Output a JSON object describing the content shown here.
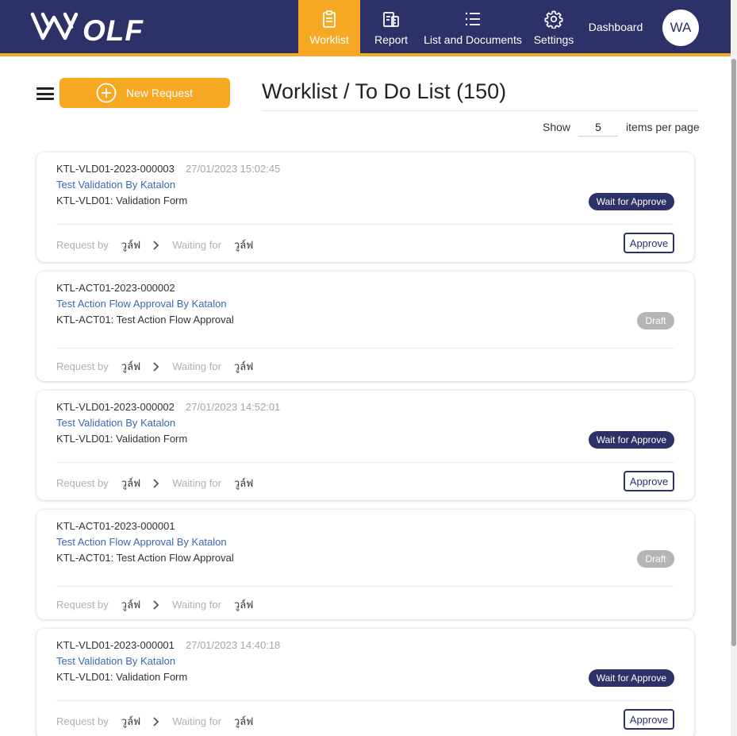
{
  "brand": {
    "logo_text": "WOLF",
    "color": "#2c3267",
    "accent": "#f7a823"
  },
  "nav": {
    "worklist": "Worklist",
    "report": "Report",
    "lists": "List and Documents",
    "settings": "Settings",
    "dashboard": "Dashboard",
    "avatar": "WA"
  },
  "toolbar": {
    "new_request": "New Request",
    "title": "Worklist / To Do List (150)",
    "show_label": "Show",
    "per_page": "5",
    "per_page_suffix": "items per page"
  },
  "footer_labels": {
    "request_by": "Request by",
    "waiting_for": "Waiting for"
  },
  "cards": [
    {
      "id": "KTL-VLD01-2023-000003",
      "date": "27/01/2023 15:02:45",
      "title": "Test Validation By Katalon",
      "form": "KTL-VLD01: Validation Form",
      "status": "Wait for Approve",
      "requester": "วูล์ฟ",
      "waiting": "วูล์ฟ",
      "action": "Approve"
    },
    {
      "id": "KTL-ACT01-2023-000002",
      "date": "",
      "title": "Test Action Flow Approval By Katalon",
      "form": "KTL-ACT01: Test Action Flow Approval",
      "status": "Draft",
      "requester": "วูล์ฟ",
      "waiting": "วูล์ฟ",
      "action": ""
    },
    {
      "id": "KTL-VLD01-2023-000002",
      "date": "27/01/2023 14:52:01",
      "title": "Test Validation By Katalon",
      "form": "KTL-VLD01: Validation Form",
      "status": "Wait for Approve",
      "requester": "วูล์ฟ",
      "waiting": "วูล์ฟ",
      "action": "Approve"
    },
    {
      "id": "KTL-ACT01-2023-000001",
      "date": "",
      "title": "Test Action Flow Approval By Katalon",
      "form": "KTL-ACT01: Test Action Flow Approval",
      "status": "Draft",
      "requester": "วูล์ฟ",
      "waiting": "วูล์ฟ",
      "action": ""
    },
    {
      "id": "KTL-VLD01-2023-000001",
      "date": "27/01/2023 14:40:18",
      "title": "Test Validation By Katalon",
      "form": "KTL-VLD01: Validation Form",
      "status": "Wait for Approve",
      "requester": "วูล์ฟ",
      "waiting": "วูล์ฟ",
      "action": "Approve"
    }
  ]
}
